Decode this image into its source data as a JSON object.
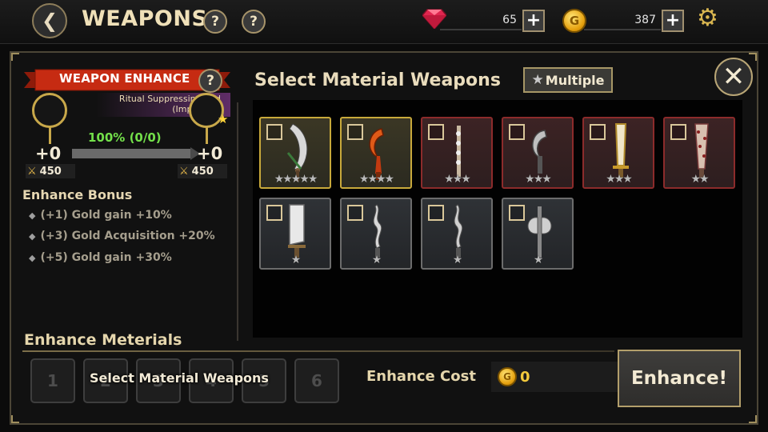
{
  "header": {
    "title": "WEAPONS",
    "help1": "?",
    "help2": "?",
    "gems": "65",
    "gold": "387",
    "plus": "+"
  },
  "enhance_panel": {
    "ribbon_label": "WEAPON ENHANCE",
    "help": "?",
    "target_line1": "Ritual Suppressing Rod",
    "target_line2": "(Improved)",
    "progress_text": "100% (0/0)",
    "progress_fraction": 1.0,
    "current_level": "+0",
    "next_level": "+0",
    "current_power": "450",
    "next_power": "450",
    "bonus_title": "Enhance Bonus",
    "bonuses": [
      "(+1) Gold gain +10%",
      "(+3) Gold Acquisition +20%",
      "(+5) Gold gain +30%"
    ]
  },
  "material_select": {
    "title": "Select Material Weapons",
    "multiple_label": "Multiple",
    "weapons": [
      {
        "name": "scythe-blade",
        "rarity": "gold",
        "stars": "★★★★★"
      },
      {
        "name": "crescent-dagger",
        "rarity": "gold",
        "stars": "★★★★"
      },
      {
        "name": "spiked-rod",
        "rarity": "red",
        "stars": "★★★"
      },
      {
        "name": "hook-blade",
        "rarity": "red",
        "stars": "★★★"
      },
      {
        "name": "golden-sword",
        "rarity": "red",
        "stars": "★★★"
      },
      {
        "name": "spiked-club",
        "rarity": "red",
        "stars": "★★"
      },
      {
        "name": "cleaver",
        "rarity": "gray",
        "stars": "★"
      },
      {
        "name": "wavy-sword",
        "rarity": "gray",
        "stars": "★"
      },
      {
        "name": "wavy-sword-2",
        "rarity": "gray",
        "stars": "★"
      },
      {
        "name": "battle-axe",
        "rarity": "gray",
        "stars": "★"
      }
    ]
  },
  "materials": {
    "title": "Enhance Meterials",
    "slots": [
      "1",
      "2",
      "3",
      "4",
      "5",
      "6"
    ],
    "overlay_label": "Select Material Weapons",
    "cost_label": "Enhance Cost",
    "cost_value": "0",
    "enhance_button": "Enhance!"
  },
  "colors": {
    "accent_gold": "#c8a93b",
    "ribbon_red": "#c62b12",
    "progress_green": "#73e04a",
    "rarity_gold": "#c8a93b",
    "rarity_red": "#8c2b2b",
    "rarity_gray": "#6c6c6c"
  }
}
